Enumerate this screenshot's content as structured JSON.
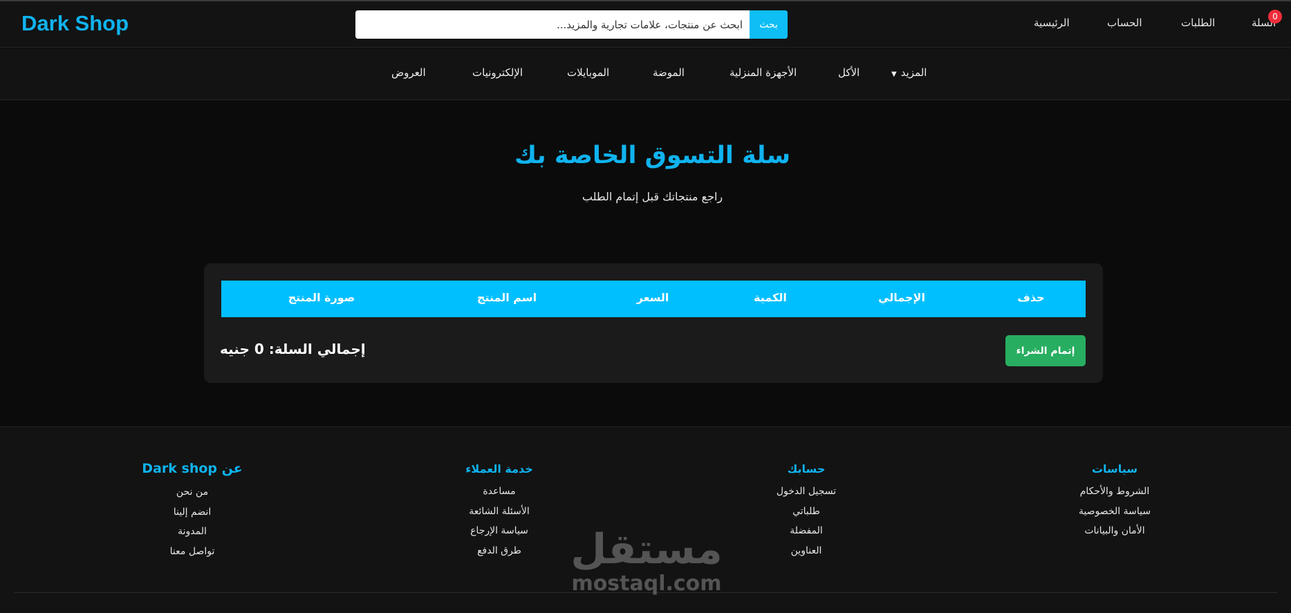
{
  "brand": {
    "logo": "Dark Shop",
    "accent_color": "#10b3ef"
  },
  "header": {
    "search_placeholder": "ابحث عن منتجات، علامات تجارية والمزيد...",
    "search_button": "بحث",
    "nav": {
      "cart": "السلة",
      "cart_count": "0",
      "orders": "الطلبات",
      "account": "الحساب",
      "home": "الرئيسية"
    }
  },
  "categories": {
    "more": "المزيد",
    "food": "الأكل",
    "home_appliances": "الأجهزة المنزلية",
    "fashion": "الموضة",
    "mobiles": "الموبايلات",
    "electronics": "الإلكترونيات",
    "offers": "العروض"
  },
  "main": {
    "title": "سلة التسوق الخاصة بك",
    "subtitle": "راجع منتجاتك قبل إتمام الطلب",
    "table_headers": [
      "حذف",
      "الإجمالي",
      "الكمية",
      "السعر",
      "اسم المنتج",
      "صورة المنتج"
    ],
    "table_header_color": "#00bfff",
    "checkout_button": "إتمام الشراء",
    "checkout_color": "#27ae60",
    "cart_total": "إجمالي السلة: 0 جنيه"
  },
  "footer": {
    "policies": {
      "title": "سياسات",
      "links": [
        "الشروط والأحكام",
        "سياسة الخصوصية",
        "الأمان والبيانات"
      ]
    },
    "account": {
      "title": "حسابك",
      "links": [
        "تسجيل الدخول",
        "طلباتي",
        "المفضلة",
        "العناوين"
      ]
    },
    "support": {
      "title": "خدمة العملاء",
      "links": [
        "مساعدة",
        "الأسئلة الشائعة",
        "سياسة الإرجاع",
        "طرق الدفع"
      ]
    },
    "about": {
      "title": "عن Dark shop",
      "links": [
        "من نحن",
        "انضم إلينا",
        "المدونة",
        "تواصل معنا"
      ]
    }
  },
  "watermark": {
    "arabic": "مستقل",
    "latin": "mostaql.com"
  }
}
